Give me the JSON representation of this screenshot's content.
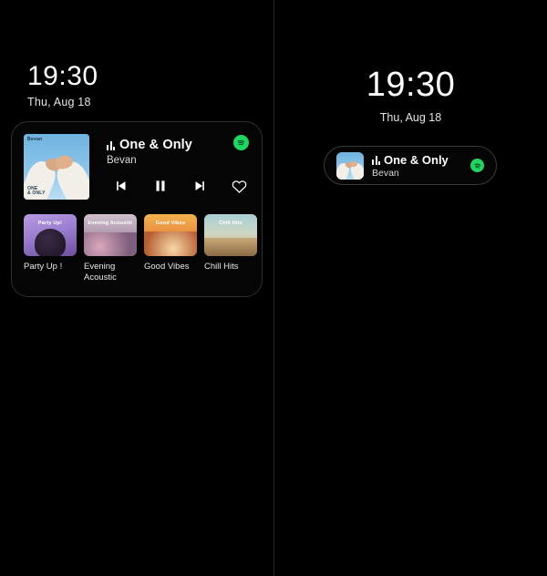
{
  "theme": {
    "background": "#000000",
    "card_background": "#050505",
    "card_border": "#2f2f2f",
    "text_primary": "#ffffff",
    "text_secondary": "#d9d9d9",
    "spotify_green": "#1ed760"
  },
  "left_panel": {
    "clock": {
      "time": "19:30",
      "date": "Thu, Aug 18"
    },
    "media_card": {
      "album_art": {
        "label_top": "Bevan",
        "label_bottom": "ONE\n& ONLY",
        "description": "two hands clasping against blue sky"
      },
      "track_title": "One & Only",
      "artist": "Bevan",
      "source_app": "Spotify",
      "eq_icon": "equalizer-icon",
      "controls": [
        {
          "name": "previous-track-button",
          "icon": "skip-previous-icon"
        },
        {
          "name": "pause-button",
          "icon": "pause-icon"
        },
        {
          "name": "next-track-button",
          "icon": "skip-next-icon"
        },
        {
          "name": "favorite-button",
          "icon": "heart-outline-icon"
        }
      ],
      "playlists": [
        {
          "label": "Party Up !",
          "overlay_text": "Party Up!",
          "theme": "thumb-party"
        },
        {
          "label": "Evening Acoustic",
          "overlay_text": "Evening Acoustic",
          "theme": "thumb-evening"
        },
        {
          "label": "Good Vibes",
          "overlay_text": "Good Vibes",
          "theme": "thumb-good"
        },
        {
          "label": "Chill Hits",
          "overlay_text": "Chill Hits",
          "theme": "thumb-chill"
        }
      ]
    }
  },
  "right_panel": {
    "clock": {
      "time": "19:30",
      "date": "Thu, Aug 18"
    },
    "media_pill": {
      "track_title": "One & Only",
      "artist": "Bevan",
      "source_app": "Spotify",
      "eq_icon": "equalizer-icon"
    }
  }
}
